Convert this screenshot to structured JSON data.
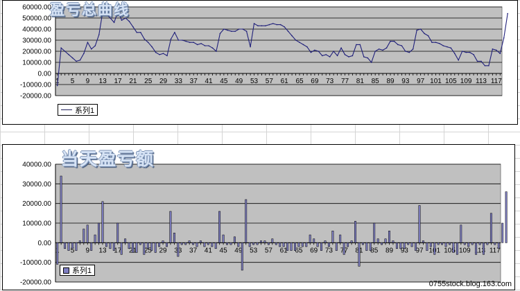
{
  "page": {
    "watermark": "0755stock.blog.163.com"
  },
  "chart_data": [
    {
      "type": "line",
      "title": "盈亏总曲线",
      "legend": "系列1",
      "legend_position": "bottom-left",
      "grid": true,
      "ylim": [
        -20000,
        60000
      ],
      "yticks": [
        60000,
        50000,
        40000,
        30000,
        20000,
        10000,
        0,
        -10000,
        -20000
      ],
      "ytick_labels": [
        "60000.00",
        "50000.00",
        "40000.00",
        "30000.00",
        "20000.00",
        "10000.00",
        "0.00",
        "-10000.00",
        "-20000.00"
      ],
      "xticks": [
        1,
        5,
        9,
        13,
        17,
        21,
        25,
        29,
        33,
        37,
        41,
        45,
        49,
        53,
        57,
        61,
        65,
        69,
        73,
        77,
        81,
        85,
        89,
        93,
        97,
        101,
        105,
        109,
        113,
        117
      ],
      "series_color": "#1f1f7a",
      "x": [
        1,
        2,
        3,
        4,
        5,
        6,
        7,
        8,
        9,
        10,
        11,
        12,
        13,
        14,
        15,
        16,
        17,
        18,
        19,
        20,
        21,
        22,
        23,
        24,
        25,
        26,
        27,
        28,
        29,
        30,
        31,
        32,
        33,
        34,
        35,
        36,
        37,
        38,
        39,
        40,
        41,
        42,
        43,
        44,
        45,
        46,
        47,
        48,
        49,
        50,
        51,
        52,
        53,
        54,
        55,
        56,
        57,
        58,
        59,
        60,
        61,
        62,
        63,
        64,
        65,
        66,
        67,
        68,
        69,
        70,
        71,
        72,
        73,
        74,
        75,
        76,
        77,
        78,
        79,
        80,
        81,
        82,
        83,
        84,
        85,
        86,
        87,
        88,
        89,
        90,
        91,
        92,
        93,
        94,
        95,
        96,
        97,
        98,
        99,
        100,
        101,
        102,
        103,
        104,
        105,
        106,
        107,
        108,
        109,
        110,
        111,
        112,
        113,
        114,
        115,
        116,
        117,
        118
      ],
      "values": [
        -11000,
        23000,
        20000,
        17000,
        14000,
        11000,
        12000,
        18000,
        28000,
        22000,
        25000,
        35000,
        56000,
        53000,
        50000,
        46000,
        56000,
        48000,
        50000,
        47000,
        42000,
        37000,
        37000,
        31000,
        28000,
        24000,
        19000,
        17000,
        18000,
        16000,
        31000,
        37000,
        30000,
        30000,
        29000,
        28000,
        28000,
        26000,
        27000,
        25000,
        25000,
        23000,
        20000,
        36000,
        40000,
        39000,
        38000,
        38000,
        40000,
        40000,
        38000,
        24000,
        45000,
        43000,
        43000,
        43000,
        44000,
        45000,
        44000,
        44000,
        42000,
        38000,
        34000,
        30000,
        28000,
        26000,
        24000,
        19000,
        21000,
        20000,
        16000,
        17000,
        15000,
        20000,
        16000,
        23000,
        17000,
        15000,
        16000,
        26000,
        26000,
        15000,
        14000,
        10000,
        20000,
        22000,
        21000,
        23000,
        29000,
        29000,
        26000,
        25000,
        20000,
        19000,
        22000,
        39000,
        40000,
        36000,
        34000,
        28000,
        28000,
        27000,
        25000,
        24000,
        23000,
        18000,
        12000,
        20000,
        19000,
        19000,
        17000,
        11000,
        11000,
        7000,
        7000,
        22000,
        21000,
        18000,
        32000,
        54000
      ]
    },
    {
      "type": "bar",
      "title": "当天盈亏额",
      "legend": "系列1",
      "legend_position": "bottom-left",
      "grid": true,
      "ylim": [
        -20000,
        40000
      ],
      "yticks": [
        40000,
        30000,
        20000,
        10000,
        0,
        -10000,
        -20000
      ],
      "ytick_labels": [
        "40000.00",
        "30000.00",
        "20000.00",
        "10000.00",
        "0.00",
        "-10000.00",
        "-20000.00"
      ],
      "xticks": [
        1,
        5,
        9,
        13,
        17,
        21,
        25,
        29,
        33,
        37,
        41,
        45,
        49,
        53,
        57,
        61,
        65,
        69,
        73,
        77,
        81,
        85,
        89,
        93,
        97,
        101,
        105,
        109,
        113,
        117
      ],
      "bar_fill": "#7f7fc2",
      "x": [
        1,
        2,
        3,
        4,
        5,
        6,
        7,
        8,
        9,
        10,
        11,
        12,
        13,
        14,
        15,
        16,
        17,
        18,
        19,
        20,
        21,
        22,
        23,
        24,
        25,
        26,
        27,
        28,
        29,
        30,
        31,
        32,
        33,
        34,
        35,
        36,
        37,
        38,
        39,
        40,
        41,
        42,
        43,
        44,
        45,
        46,
        47,
        48,
        49,
        50,
        51,
        52,
        53,
        54,
        55,
        56,
        57,
        58,
        59,
        60,
        61,
        62,
        63,
        64,
        65,
        66,
        67,
        68,
        69,
        70,
        71,
        72,
        73,
        74,
        75,
        76,
        77,
        78,
        79,
        80,
        81,
        82,
        83,
        84,
        85,
        86,
        87,
        88,
        89,
        90,
        91,
        92,
        93,
        94,
        95,
        96,
        97,
        98,
        99,
        100,
        101,
        102,
        103,
        104,
        105,
        106,
        107,
        108,
        109,
        110,
        111,
        112,
        113,
        114,
        115,
        116,
        117,
        118
      ],
      "values": [
        -11000,
        34000,
        -3000,
        -4000,
        -3000,
        -4000,
        1000,
        7000,
        9000,
        -4000,
        4000,
        10000,
        21000,
        -2000,
        -3000,
        -4000,
        10000,
        -6000,
        2000,
        -3000,
        -5000,
        -5000,
        -1000,
        -6000,
        -3000,
        -4000,
        -5000,
        -2000,
        1000,
        -2000,
        16000,
        5000,
        -7000,
        -1000,
        -1000,
        1000,
        -1000,
        -2000,
        1000,
        -2000,
        -1000,
        -2000,
        -3000,
        16000,
        4000,
        -1000,
        -1000,
        3000,
        -2000,
        -14000,
        22000,
        -2000,
        -1000,
        -1000,
        1000,
        1000,
        -1000,
        2000,
        -1000,
        -2000,
        -2000,
        -4000,
        -4000,
        -4000,
        -2000,
        -2000,
        -2000,
        4000,
        2000,
        -2000,
        -4000,
        1000,
        -2000,
        6000,
        -4000,
        4000,
        -6000,
        -2000,
        1000,
        11000,
        -12000,
        -1000,
        -4000,
        -4000,
        10000,
        2000,
        -1000,
        2000,
        6000,
        1000,
        -3000,
        -3000,
        -3000,
        -1000,
        -2000,
        -4000,
        19000,
        1000,
        -4000,
        -2000,
        -6000,
        -1000,
        -1000,
        -2000,
        -1000,
        -5000,
        -6000,
        9000,
        -1000,
        -2000,
        -1000,
        -6000,
        -1000,
        -6000,
        -1000,
        15000,
        -1000,
        -3000,
        10000,
        26000
      ]
    }
  ]
}
